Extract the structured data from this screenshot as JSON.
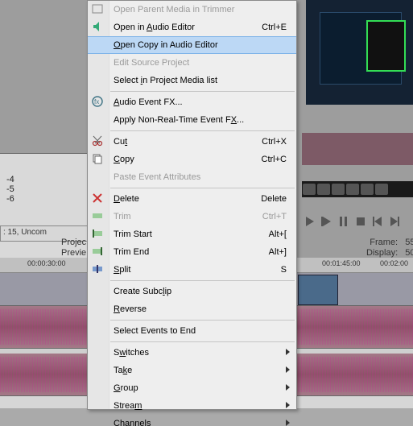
{
  "panel_left": {
    "list_items": [
      "-4",
      "-5",
      "-6"
    ],
    "status": ": 15, Uncom"
  },
  "labels_left": {
    "l1": "Projec",
    "l2": "Previe"
  },
  "preview": {
    "frame_label": "Frame:",
    "frame_val": "55",
    "display_label": "Display:",
    "display_val": "50"
  },
  "timeline": {
    "t1": "00:00:30:00",
    "t2": "00:01:45:00",
    "t3": "00:02:00"
  },
  "menu": [
    {
      "label": "Open Parent Media in Trimmer",
      "disabled": true,
      "icon": "trimmer"
    },
    {
      "label": "Open in Audio Editor",
      "u": "A",
      "shortcut": "Ctrl+E",
      "icon": "audio"
    },
    {
      "label": "Open Copy in Audio Editor",
      "u": "O",
      "hover": true
    },
    {
      "label": "Edit Source Project",
      "disabled": true
    },
    {
      "label": "Select in Project Media list",
      "u": "i"
    },
    {
      "sep": true
    },
    {
      "label": "Audio Event FX...",
      "u": "A",
      "icon": "fx"
    },
    {
      "label": "Apply Non-Real-Time Event FX...",
      "u": "X"
    },
    {
      "sep": true
    },
    {
      "label": "Cut",
      "u": "t",
      "shortcut": "Ctrl+X",
      "icon": "cut"
    },
    {
      "label": "Copy",
      "u": "C",
      "shortcut": "Ctrl+C",
      "icon": "copy"
    },
    {
      "label": "Paste Event Attributes",
      "disabled": true
    },
    {
      "sep": true
    },
    {
      "label": "Delete",
      "u": "D",
      "shortcut": "Delete",
      "icon": "delete"
    },
    {
      "label": "Trim",
      "disabled": true,
      "shortcut": "Ctrl+T",
      "icon": "trim"
    },
    {
      "label": "Trim Start",
      "shortcut": "Alt+[",
      "icon": "trimstart"
    },
    {
      "label": "Trim End",
      "shortcut": "Alt+]",
      "icon": "trimend"
    },
    {
      "label": "Split",
      "u": "S",
      "shortcut": "S",
      "icon": "split"
    },
    {
      "sep": true
    },
    {
      "label": "Create Subclip",
      "u": "l"
    },
    {
      "label": "Reverse",
      "u": "R"
    },
    {
      "sep": true
    },
    {
      "label": "Select Events to End"
    },
    {
      "sep": true
    },
    {
      "label": "Switches",
      "u": "w",
      "submenu": true
    },
    {
      "label": "Take",
      "u": "k",
      "submenu": true
    },
    {
      "label": "Group",
      "u": "G",
      "submenu": true
    },
    {
      "label": "Stream",
      "u": "m",
      "submenu": true
    },
    {
      "label": "Channels",
      "submenu": true,
      "partial": true
    }
  ]
}
